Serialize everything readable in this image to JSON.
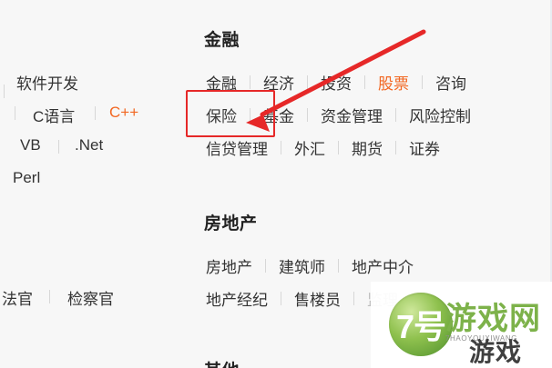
{
  "colors": {
    "accent": "#f26722",
    "highlight": "#e62828",
    "text": "#333333",
    "title": "#222222",
    "separator": "#d7d7d7",
    "background": "#f7f7f7"
  },
  "left_column": {
    "rows": [
      {
        "items": [
          "软件开发"
        ]
      },
      {
        "items": [
          "C语言",
          "C++"
        ]
      },
      {
        "items": [
          "VB",
          ".Net"
        ]
      },
      {
        "items": [
          "Perl"
        ]
      },
      {
        "items": [
          "法官",
          "检察官"
        ]
      }
    ]
  },
  "finance": {
    "title": "金融",
    "row1": [
      "金融",
      "经济",
      "投资",
      "股票",
      "咨询"
    ],
    "row2": [
      "保险",
      "基金",
      "资金管理",
      "风险控制"
    ],
    "row3": [
      "信贷管理",
      "外汇",
      "期货",
      "证券"
    ]
  },
  "real_estate": {
    "title": "房地产",
    "row1": [
      "房地产",
      "建筑师",
      "地产中介"
    ],
    "row2": [
      "地产经纪",
      "售楼员",
      "监理"
    ]
  },
  "other": {
    "title": "其他"
  },
  "watermark": {
    "badge": "7号",
    "title": "游戏网",
    "subtitle": "7HAOYOUXIWANG",
    "game": "游戏"
  },
  "icons": {
    "pointer": "arrow-pointer-icon"
  }
}
